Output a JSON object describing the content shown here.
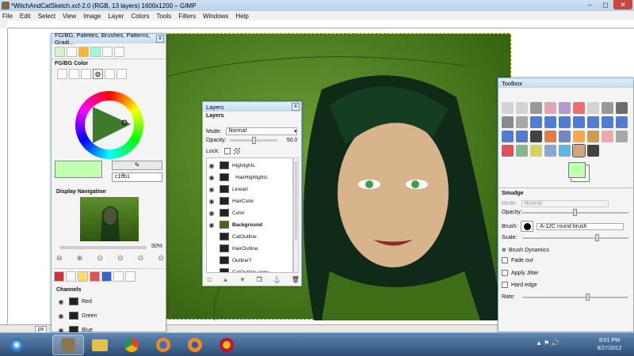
{
  "window": {
    "title": "*WitchAndCatSketch.xcf-2.0 (RGB, 13 layers) 1600x1200 – GIMP"
  },
  "menu": [
    "File",
    "Edit",
    "Select",
    "View",
    "Image",
    "Layer",
    "Colors",
    "Tools",
    "Filters",
    "Windows",
    "Help"
  ],
  "dock_left": {
    "title": "FG/BG, Palettes, Brushes, Patterns, Gradi...",
    "fgbg_label": "FG/BG Color",
    "hex_value": "c1ffb1",
    "nav_label": "Display Navigation",
    "zoom": "50%",
    "channels_label": "Channels",
    "channels": [
      "Red",
      "Green",
      "Blue"
    ]
  },
  "layers": {
    "title": "Layers",
    "section": "Layers",
    "mode_label": "Mode:",
    "mode_value": "Normal",
    "opacity_label": "Opacity:",
    "opacity_value": "50.0",
    "lock_label": "Lock:",
    "items": [
      "Highlights",
      "HairHighlights",
      "Lineart",
      "HairColor",
      "Color",
      "Background",
      "CatOutline",
      "HairOutline",
      "Outline?",
      "CatOutline copy"
    ]
  },
  "toolbox": {
    "title": "Toolbox",
    "tool_name": "Smudge",
    "mode_label": "Mode:",
    "mode_value": "Normal",
    "opacity_label": "Opacity:",
    "brush_label": "Brush:",
    "brush_value": "A-12C round brush",
    "scale_label": "Scale:",
    "dynamics_label": "Brush Dynamics",
    "fade_label": "Fade out",
    "jitter_label": "Apply Jitter",
    "hardedge_label": "Hard edge",
    "rate_label": "Rate:"
  },
  "status": {
    "unit": "px"
  },
  "taskbar": {
    "time": "8:01 PM",
    "date": "9/27/2012"
  },
  "colors": {
    "fg": "#c1ffb1",
    "accent": "#4a7a1e"
  }
}
